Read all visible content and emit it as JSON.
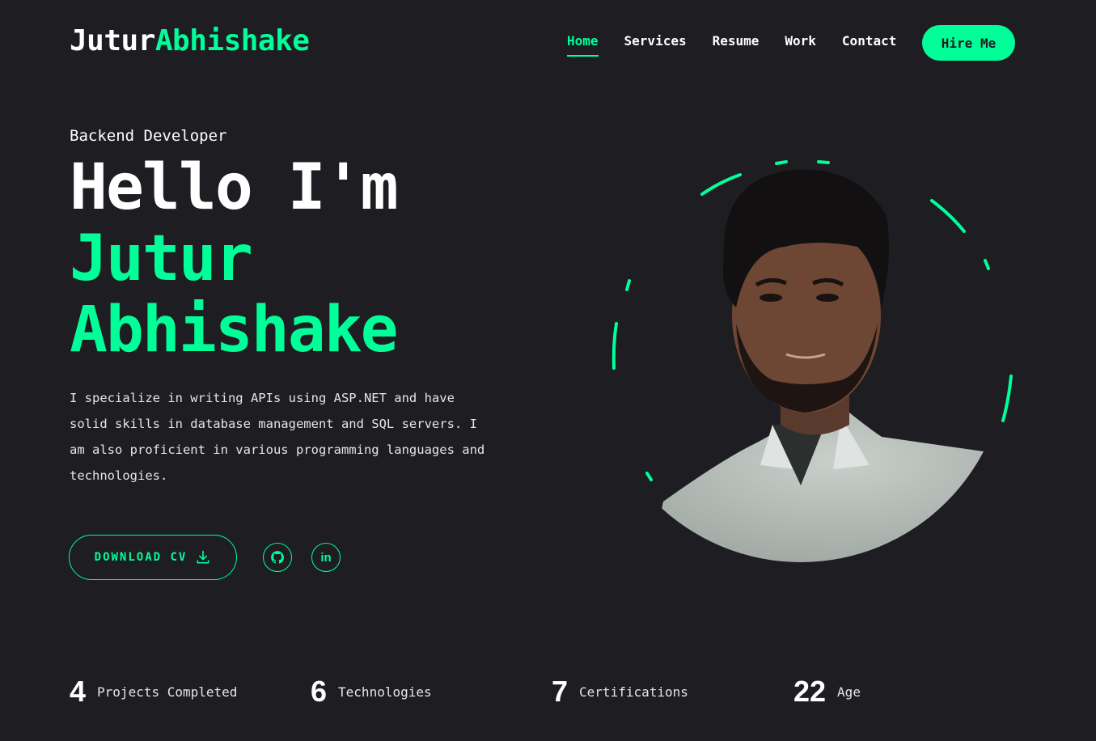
{
  "header": {
    "logo_first": "Jutur",
    "logo_second": "Abhishake",
    "nav": [
      "Home",
      "Services",
      "Resume",
      "Work",
      "Contact"
    ],
    "hire_label": "Hire Me"
  },
  "hero": {
    "role": "Backend Developer",
    "greeting": "Hello I'm",
    "name_line1": "Jutur",
    "name_line2": "Abhishake",
    "description": "I specialize in writing APIs using ASP.NET and have solid skills in database management and SQL servers. I am also proficient in various programming languages and technologies.",
    "download_label": "DOWNLOAD CV",
    "download_icon": "download-icon",
    "social": [
      {
        "icon": "github-icon"
      },
      {
        "icon": "linkedin-icon",
        "text": "in"
      }
    ]
  },
  "stats": [
    {
      "num": "4",
      "label": "Projects Completed"
    },
    {
      "num": "6",
      "label": "Technologies"
    },
    {
      "num": "7",
      "label": "Certifications"
    },
    {
      "num": "22",
      "label": "Age"
    }
  ],
  "colors": {
    "background": "#1d1d22",
    "accent": "#00ff99",
    "text": "#ffffff"
  }
}
